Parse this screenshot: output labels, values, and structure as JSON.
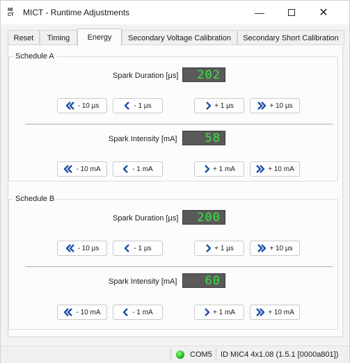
{
  "window": {
    "logo_top": "MI",
    "logo_bottom": "CT",
    "title": "MICT - Runtime Adjustments",
    "minimize_glyph": "—",
    "close_glyph": "✕"
  },
  "tabs": [
    {
      "label": "Reset"
    },
    {
      "label": "Timing"
    },
    {
      "label": "Energy",
      "active": true
    },
    {
      "label": "Secondary Voltage Calibration"
    },
    {
      "label": "Secondary Short Calibration"
    }
  ],
  "schedule_a": {
    "title": "Schedule A",
    "duration": {
      "label": "Spark Duration [µs]",
      "value": "202",
      "buttons": {
        "dec_big": "- 10 µs",
        "dec_small": "- 1 µs",
        "inc_small": "+ 1 µs",
        "inc_big": "+ 10 µs"
      }
    },
    "intensity": {
      "label": "Spark Intensity [mA]",
      "value": "58",
      "buttons": {
        "dec_big": "- 10 mA",
        "dec_small": "- 1 mA",
        "inc_small": "+ 1 mA",
        "inc_big": "+ 10 mA"
      }
    }
  },
  "schedule_b": {
    "title": "Schedule B",
    "duration": {
      "label": "Spark Duration [µs]",
      "value": "200",
      "buttons": {
        "dec_big": "- 10 µs",
        "dec_small": "- 1 µs",
        "inc_small": "+ 1 µs",
        "inc_big": "+ 10 µs"
      }
    },
    "intensity": {
      "label": "Spark Intensity [mA]",
      "value": "60",
      "buttons": {
        "dec_big": "- 10 mA",
        "dec_small": "- 1 mA",
        "inc_small": "+ 1 mA",
        "inc_big": "+ 10 mA"
      }
    }
  },
  "status": {
    "connection_color": "#1eb51e",
    "port": "COM5",
    "device": "ID MIC4 4x1.08 (1.5.1 [0000a801])"
  },
  "colors": {
    "lcd_background": "#5a5a5a",
    "lcd_digits": "#3fe04a",
    "arrow_icon": "#1f4fa8"
  }
}
